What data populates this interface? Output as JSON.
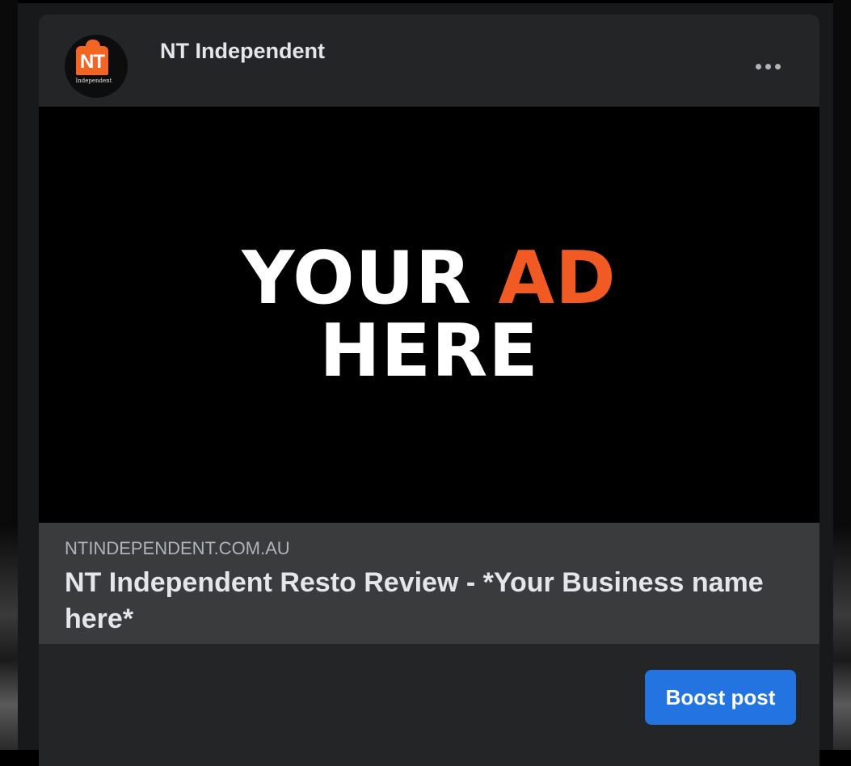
{
  "post": {
    "page_name": "NT Independent",
    "avatar": {
      "logo_text": "NT",
      "logo_subtext": "Independent",
      "accent_color": "#f26522"
    },
    "more_icon": "more-horizontal-icon",
    "media": {
      "line1_main": "YOUR",
      "line1_accent": "AD",
      "line2": "HERE",
      "accent_color": "#f15a22"
    },
    "link": {
      "domain": "NTINDEPENDENT.COM.AU",
      "title": "NT Independent Resto Review - *Your Business name here*"
    },
    "footer": {
      "boost_label": "Boost post",
      "boost_color": "#2374e1"
    }
  }
}
